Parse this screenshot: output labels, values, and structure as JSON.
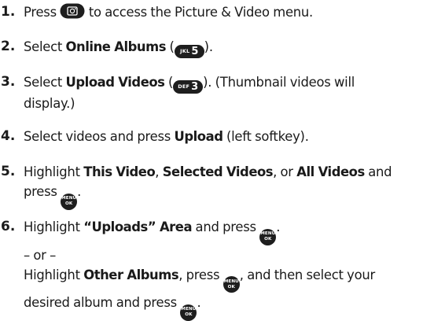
{
  "steps": [
    {
      "number": "1.",
      "lines": [
        [
          {
            "t": "Press "
          },
          {
            "key": "camera"
          },
          {
            "t": " to access the Picture & Video menu."
          }
        ]
      ]
    },
    {
      "number": "2.",
      "lines": [
        [
          {
            "t": "Select "
          },
          {
            "b": "Online Albums"
          },
          {
            "t": " ("
          },
          {
            "key": "pill",
            "small": "JKL",
            "big": "5"
          },
          {
            "t": ")."
          }
        ]
      ]
    },
    {
      "number": "3.",
      "lines": [
        [
          {
            "t": "Select "
          },
          {
            "b": "Upload Videos"
          },
          {
            "t": " ("
          },
          {
            "key": "pill",
            "small": "DEF",
            "big": "3"
          },
          {
            "t": "). (Thumbnail videos will"
          }
        ],
        [
          {
            "t": "display.)"
          }
        ]
      ]
    },
    {
      "number": "4.",
      "lines": [
        [
          {
            "t": "Select videos and press "
          },
          {
            "b": "Upload"
          },
          {
            "t": " (left softkey)."
          }
        ]
      ]
    },
    {
      "number": "5.",
      "lines": [
        [
          {
            "t": "Highlight "
          },
          {
            "b": "This Video"
          },
          {
            "t": ", "
          },
          {
            "b": "Selected Videos"
          },
          {
            "t": ", or "
          },
          {
            "b": "All Videos"
          },
          {
            "t": " and"
          }
        ],
        [
          {
            "t": "press "
          },
          {
            "key": "menu",
            "top": "MENU",
            "bottom": "OK"
          },
          {
            "t": "."
          }
        ]
      ]
    },
    {
      "number": "6.",
      "lines": [
        [
          {
            "t": "Highlight "
          },
          {
            "b": "“Uploads” Area"
          },
          {
            "t": " and press "
          },
          {
            "key": "menu",
            "top": "MENU",
            "bottom": "OK"
          },
          {
            "t": "."
          }
        ],
        [
          {
            "t": "– or –"
          }
        ],
        [
          {
            "t": "Highlight "
          },
          {
            "b": "Other Albums"
          },
          {
            "t": ", press "
          },
          {
            "key": "menu",
            "top": "MENU",
            "bottom": "OK"
          },
          {
            "t": ", and then select your"
          }
        ],
        [
          {
            "t": "desired album and press "
          },
          {
            "key": "menu",
            "top": "MENU",
            "bottom": "OK"
          },
          {
            "t": "."
          }
        ]
      ]
    }
  ]
}
